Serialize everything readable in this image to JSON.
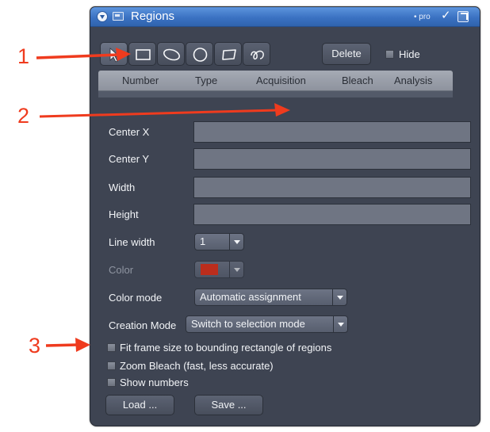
{
  "panel": {
    "title": "Regions",
    "badge": "• pro",
    "check_icon": "checkmark-icon",
    "popout_icon": "popout-icon"
  },
  "tools": [
    {
      "name": "pointer-tool",
      "icon": "pointer-arrow-icon"
    },
    {
      "name": "rectangle-tool",
      "icon": "rectangle-icon"
    },
    {
      "name": "ellipse-tool",
      "icon": "ellipse-icon"
    },
    {
      "name": "circle-tool",
      "icon": "circle-icon"
    },
    {
      "name": "polygon-tool",
      "icon": "polygon-icon"
    },
    {
      "name": "freehand-tool",
      "icon": "freehand-icon"
    }
  ],
  "toolbar": {
    "delete_label": "Delete",
    "hide_label": "Hide"
  },
  "table": {
    "columns": [
      "Number",
      "Type",
      "Acquisition",
      "Bleach",
      "Analysis"
    ]
  },
  "fields": {
    "center_x": {
      "label": "Center X",
      "value": ""
    },
    "center_y": {
      "label": "Center Y",
      "value": ""
    },
    "width": {
      "label": "Width",
      "value": ""
    },
    "height": {
      "label": "Height",
      "value": ""
    }
  },
  "line_width": {
    "label": "Line width",
    "value": "1"
  },
  "color": {
    "label": "Color",
    "value": "#ff2200"
  },
  "color_mode": {
    "label": "Color mode",
    "value": "Automatic assignment"
  },
  "creation_mode": {
    "label": "Creation Mode",
    "value": "Switch to selection mode"
  },
  "options": {
    "fit_frame": "Fit frame size to bounding rectangle of regions",
    "zoom_bleach": "Zoom Bleach (fast, less accurate)",
    "show_numbers": "Show numbers"
  },
  "buttons": {
    "load": "Load ...",
    "save": "Save ..."
  },
  "annotations": {
    "one": "1",
    "two": "2",
    "three": "3",
    "color": "#ef3b1e"
  }
}
